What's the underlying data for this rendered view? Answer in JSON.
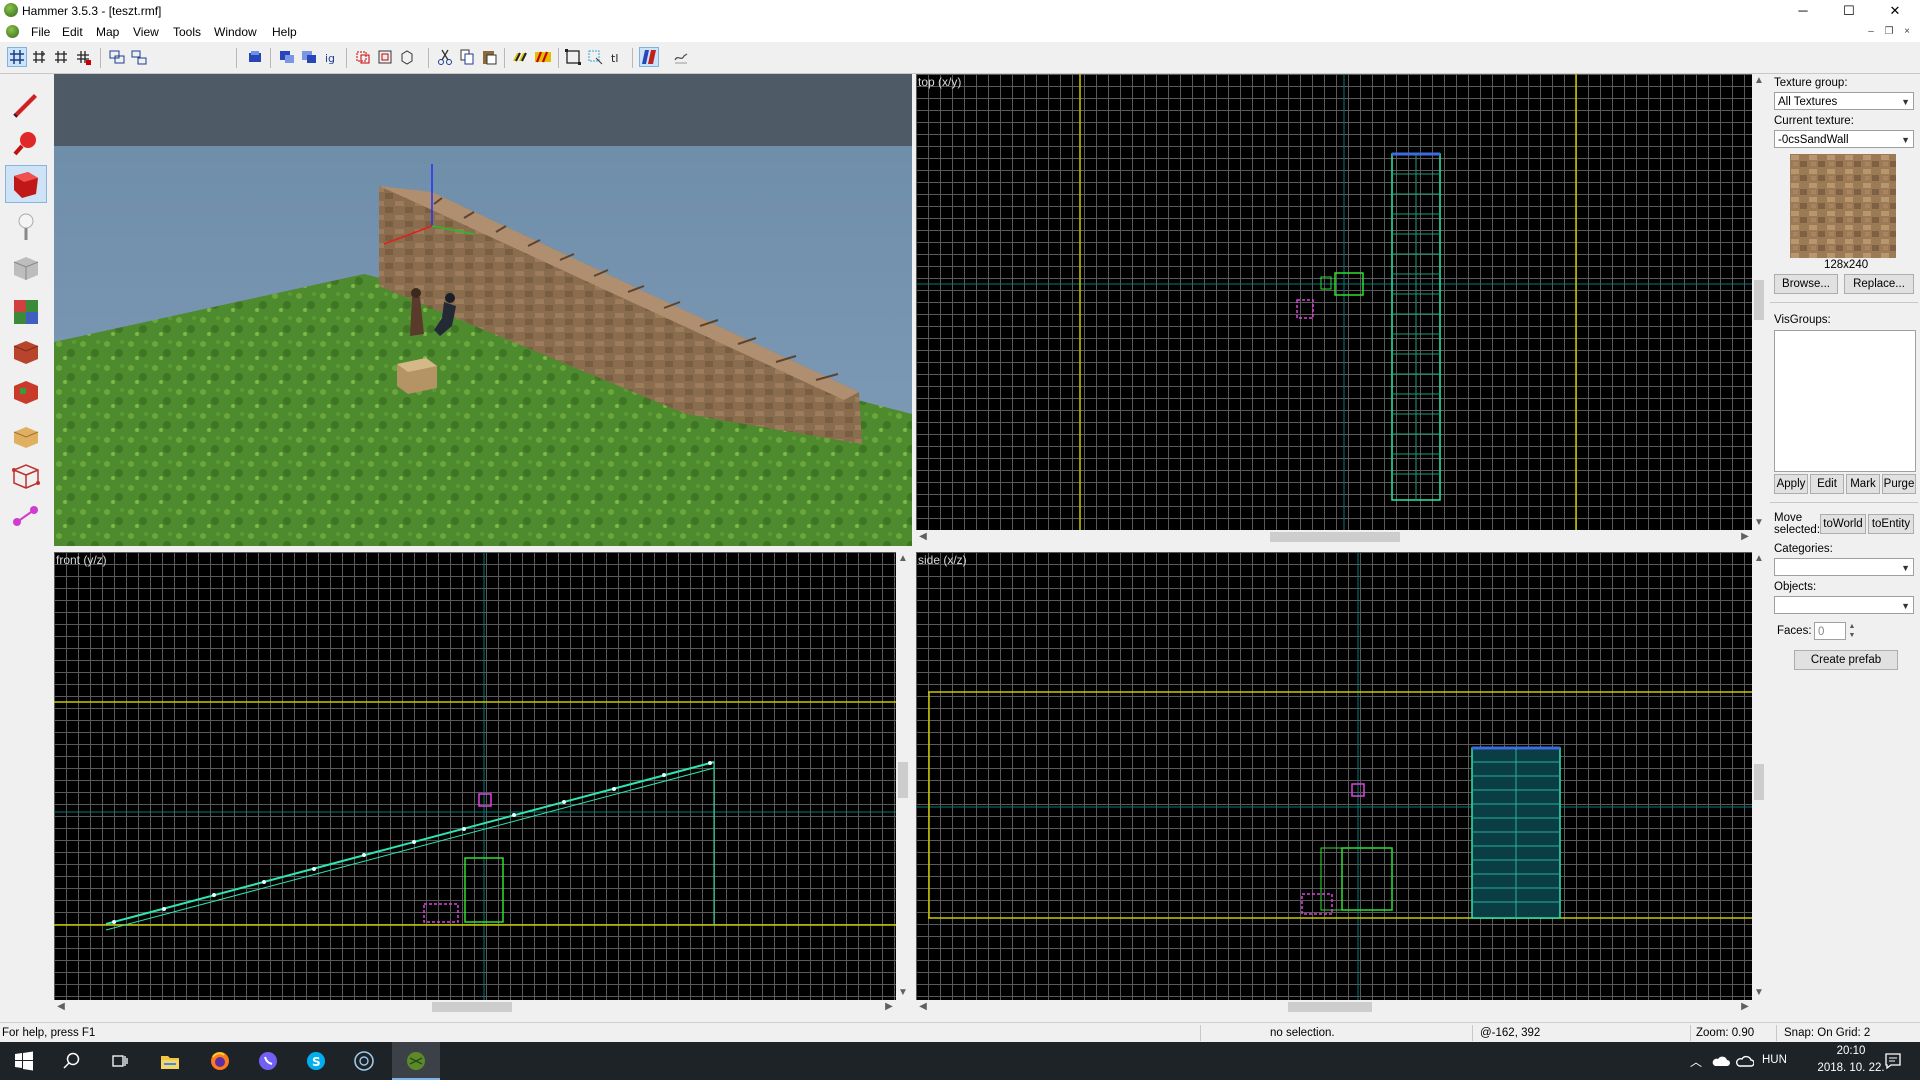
{
  "window": {
    "title": "Hammer 3.5.3 - [teszt.rmf]",
    "minimize": "─",
    "maximize": "☐",
    "close": "✕"
  },
  "menu": {
    "items": [
      "File",
      "Edit",
      "Map",
      "View",
      "Tools",
      "Window",
      "Help"
    ],
    "mdi_min": "–",
    "mdi_restore": "❐",
    "mdi_close": "×"
  },
  "viewports": {
    "top_label": "top (x/y)",
    "front_label": "front (y/z)",
    "side_label": "side (x/z)"
  },
  "right_panel": {
    "texture_group_label": "Texture group:",
    "texture_group_value": "All Textures",
    "current_texture_label": "Current texture:",
    "current_texture_value": "-0csSandWall",
    "texture_size": "128x240",
    "browse": "Browse...",
    "replace": "Replace...",
    "visgroups_label": "VisGroups:",
    "apply": "Apply",
    "edit": "Edit",
    "mark": "Mark",
    "purge": "Purge",
    "move_selected_label": "Move selected:",
    "to_world": "toWorld",
    "to_entity": "toEntity",
    "categories_label": "Categories:",
    "objects_label": "Objects:",
    "faces_label": "Faces:",
    "faces_value": "0",
    "create_prefab": "Create prefab"
  },
  "status": {
    "help": "For help, press F1",
    "selection": "no selection.",
    "coords": "@-162, 392",
    "zoom": "Zoom: 0.90",
    "snap": "Snap: On Grid: 2"
  },
  "taskbar": {
    "language": "HUN",
    "time": "20:10",
    "date": "2018. 10. 22."
  },
  "colors": {
    "grid_yellow": "#c8c800",
    "brush_green": "#2ee6b0",
    "entity_magenta": "#e040e0",
    "cyan_axis": "#00a0a0"
  }
}
